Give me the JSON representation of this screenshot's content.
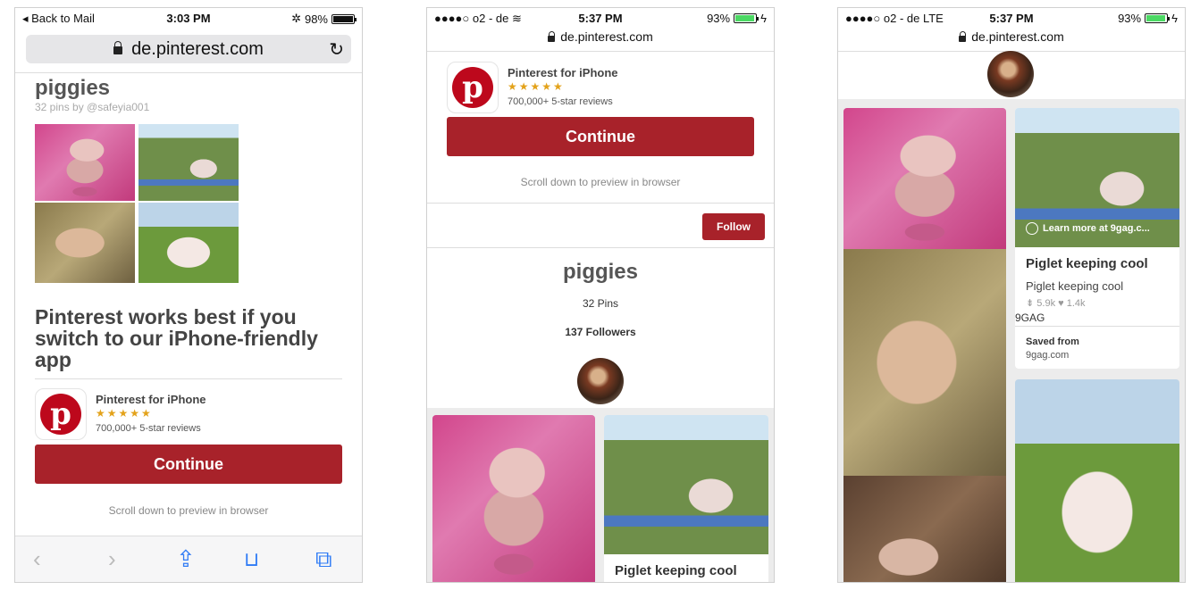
{
  "screen1": {
    "status": {
      "back": "◂ Back to Mail",
      "time": "3:03 PM",
      "battery": "98%"
    },
    "url": "de.pinterest.com",
    "board": {
      "title": "piggies",
      "subtitle": "32 pins by @safeyia001"
    },
    "headline": "Pinterest works best if you switch to our iPhone-friendly app",
    "app": {
      "name": "Pinterest for iPhone",
      "stars": "★★★★★",
      "reviews": "700,000+ 5-star reviews"
    },
    "continue_label": "Continue",
    "scroll_hint": "Scroll down to preview in browser",
    "toolbar": {
      "back": "‹",
      "forward": "›",
      "share": "⇪",
      "bookmarks": "📖",
      "tabs": "⧉"
    }
  },
  "screen2": {
    "status": {
      "carrier": "●●●●○ o2 - de ≋",
      "time": "5:37 PM",
      "battery": "93%"
    },
    "url": "de.pinterest.com",
    "app": {
      "name": "Pinterest for iPhone",
      "stars": "★★★★★",
      "reviews": "700,000+ 5-star reviews"
    },
    "continue_label": "Continue",
    "scroll_hint": "Scroll down to preview in browser",
    "follow_label": "Follow",
    "board": {
      "title": "piggies",
      "pins": "32 Pins",
      "followers": "137 Followers"
    },
    "pin_title": "Piglet keeping cool"
  },
  "screen3": {
    "status": {
      "carrier": "●●●●○ o2 - de  LTE",
      "time": "5:37 PM",
      "battery": "93%"
    },
    "url": "de.pinterest.com",
    "learn_more": "Learn more at 9gag.c...",
    "pin_title": "Piglet keeping cool",
    "pin_desc": "Piglet keeping cool",
    "pin_stats": "⇟ 5.9k  ♥ 1.4k",
    "source": "9GAG",
    "saved_from": "Saved from",
    "saved_url": "9gag.com"
  },
  "colors": {
    "brand": "#bd081c",
    "cta": "#a8222a",
    "stars": "#e3a21a",
    "ios_blue": "#2f7bf5"
  }
}
